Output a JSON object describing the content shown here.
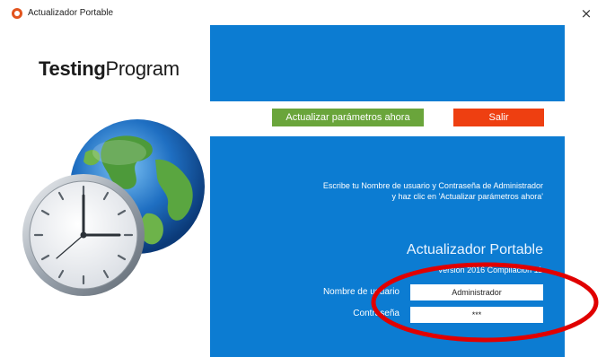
{
  "window": {
    "title": "Actualizador Portable",
    "close_glyph": "×"
  },
  "brand": {
    "part1": "Testing",
    "part2": "Program"
  },
  "buttons": {
    "update": "Actualizar parámetros ahora",
    "exit": "Salir"
  },
  "instructions": {
    "line1": "Escribe tu Nombre de usuario y Contraseña de Administrador",
    "line2": "y haz clic en 'Actualizar parámetros ahora'"
  },
  "product": {
    "name": "Actualizador Portable",
    "version": "Versión 2016 Compilación 11"
  },
  "form": {
    "username_label": "Nombre de usuario",
    "username_value": "Administrador",
    "password_label": "Contraseña",
    "password_value": "***"
  },
  "colors": {
    "panel_blue": "#0c7cd2",
    "update_green": "#6aa53b",
    "exit_orange": "#ee3f11",
    "annotation_red": "#e00000"
  },
  "icons": {
    "app": "updater-app-icon",
    "illustration": "globe-clock-icon"
  }
}
